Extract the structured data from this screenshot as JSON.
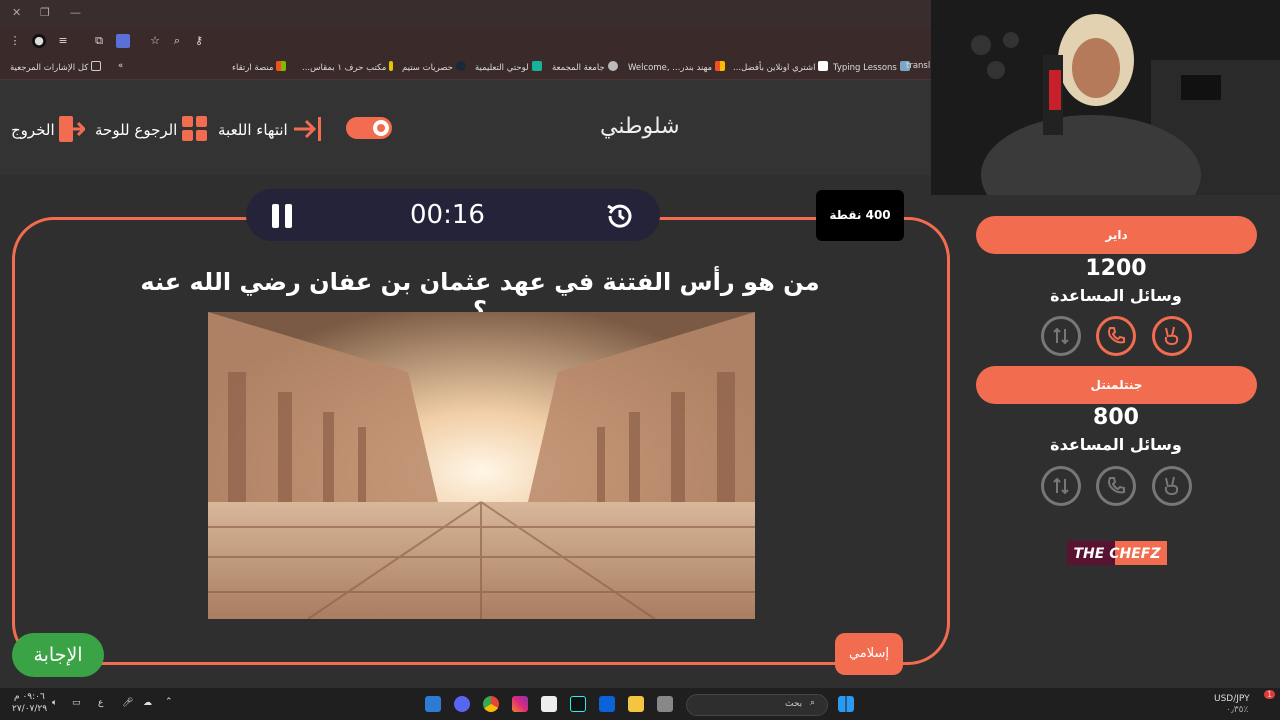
{
  "browser": {
    "bookmarks": [
      "transl",
      "Typing Lessons",
      "اشتري اونلاين بأفضل...",
      "مهند بندر... ,Welcome",
      "جامعة المجمعة",
      "لوحتي التعليمية",
      "حصريات ستيم",
      "مكتب حرف ۱ بمقاس...",
      "منصة ارتقاء",
      "كل الإشارات المرجعية"
    ],
    "bookmarks_overflow": "»"
  },
  "header": {
    "title": "شلوطني",
    "end_game": "انتهاء اللعبة",
    "back_to_board": "الرجوع للوحة",
    "exit": "الخروج"
  },
  "game": {
    "timer": "00:16",
    "points": "400 نقطة",
    "question": "من هو رأس الفتنة في عهد عثمان بن عفان رضي الله عنه ؟",
    "category": "إسلامي",
    "answer_button": "الإجابة"
  },
  "teams": [
    {
      "name": "داير",
      "score": "1200",
      "aids_label": "وسائل المساعدة"
    },
    {
      "name": "جنتلمنتل",
      "score": "800",
      "aids_label": "وسائل المساعدة"
    }
  ],
  "sponsor": {
    "text": "THE CHEFZ"
  },
  "taskbar": {
    "search_placeholder": "بحث",
    "currency": "USD/JPY",
    "currency_change": "٠٫٣٥٪",
    "time": "٠٩:٠٦ م",
    "date": "٢٧/٠٧/٢٩",
    "lang": "ع",
    "notification_count": "1"
  },
  "colors": {
    "accent": "#f26c4f",
    "answer_green": "#39a346",
    "timer_bg": "#25233a",
    "background": "#2f2f2f"
  }
}
